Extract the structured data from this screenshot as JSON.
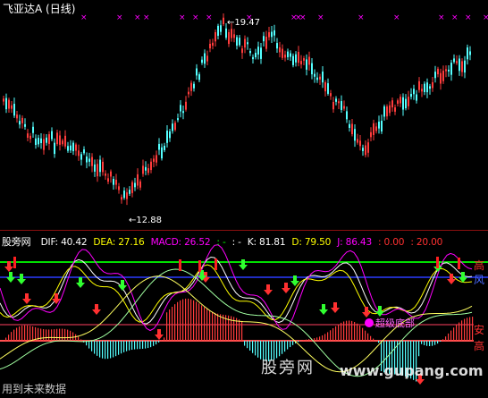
{
  "main_panel": {
    "title": "飞亚达A (日线)",
    "high_label": "19.47",
    "low_label": "12.88"
  },
  "indicator_panel": {
    "name": "股旁网",
    "values": [
      {
        "label": "DIF: 40.42",
        "color": "#ffffff"
      },
      {
        "label": "DEA: 27.16",
        "color": "#ffff00"
      },
      {
        "label": "MACD: 26.52",
        "color": "#ff00ff"
      },
      {
        "label": ": -",
        "color": "#00ff00"
      },
      {
        "label": ": -",
        "color": "#ffffff"
      },
      {
        "label": "K: 81.81",
        "color": "#ffffff"
      },
      {
        "label": "D: 79.50",
        "color": "#ffff00"
      },
      {
        "label": "J: 86.43",
        "color": "#ff00ff"
      },
      {
        "label": ": 0.00",
        "color": "#ff3030"
      },
      {
        "label": ": 20.00",
        "color": "#ff3030"
      }
    ],
    "side_labels": {
      "gao_top": "高",
      "feng": "风",
      "an": "安",
      "gao_bottom": "高"
    },
    "bottom_signal": "超级底部",
    "footer": "用到未来数据",
    "watermark": {
      "cn": "股旁网",
      "url": "www.gupang.com"
    }
  },
  "colors": {
    "up": "#ff3c3c",
    "down": "#54ffff",
    "accent": "#ff00ff"
  }
}
